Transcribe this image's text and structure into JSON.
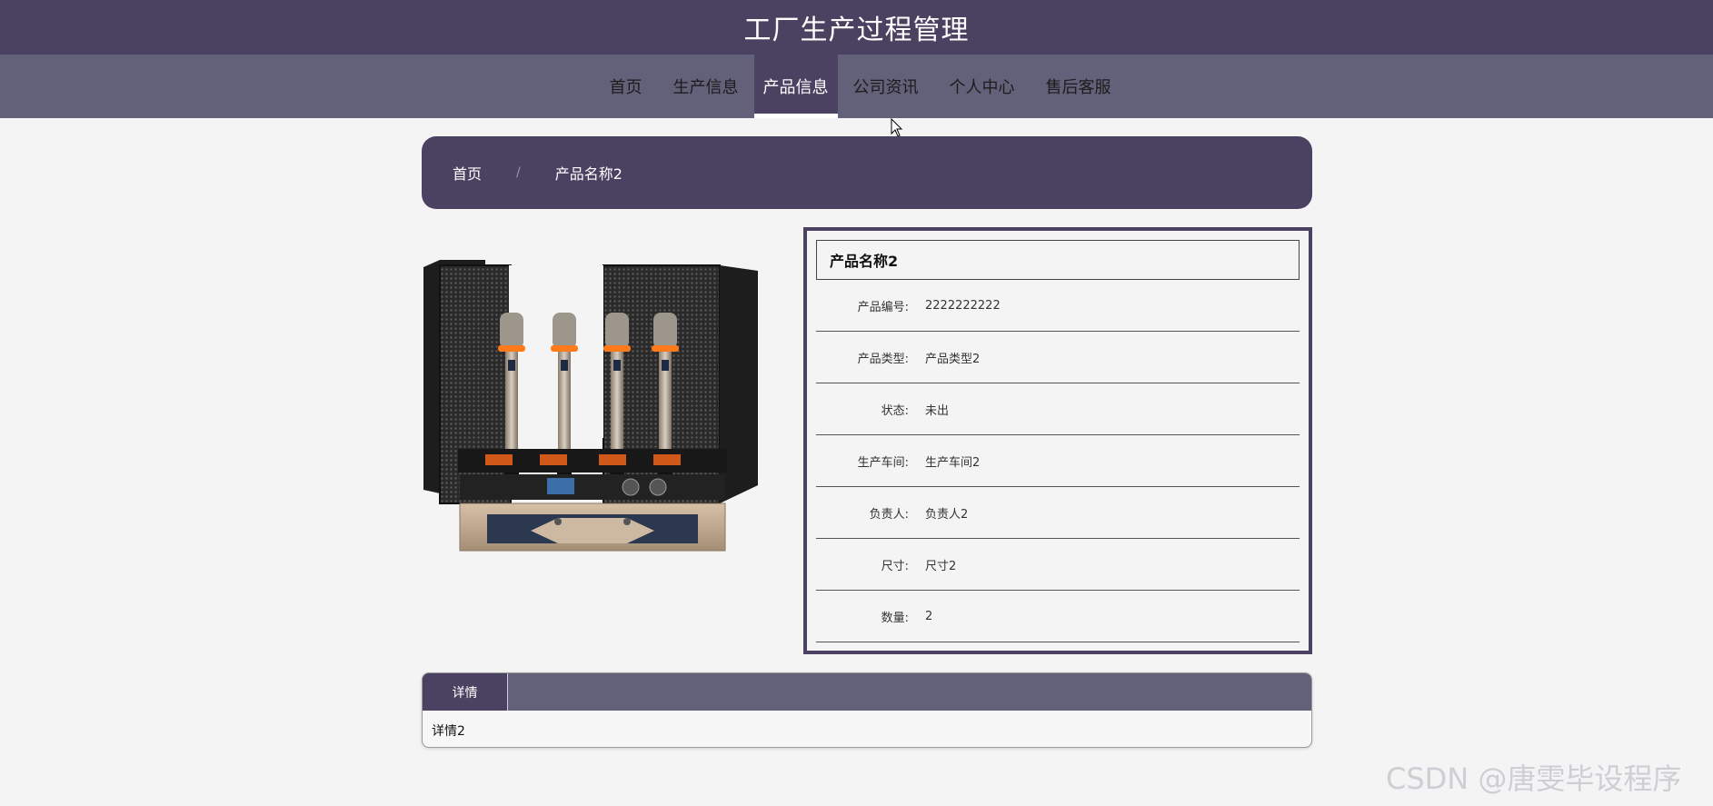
{
  "site": {
    "title": "工厂生产过程管理"
  },
  "nav": {
    "items": [
      {
        "label": "首页"
      },
      {
        "label": "生产信息"
      },
      {
        "label": "产品信息"
      },
      {
        "label": "公司资讯"
      },
      {
        "label": "个人中心"
      },
      {
        "label": "售后客服"
      }
    ],
    "active_index": 2
  },
  "breadcrumb": {
    "home": "首页",
    "separator": "/",
    "current": "产品名称2"
  },
  "product": {
    "name": "产品名称2",
    "fields": [
      {
        "label": "产品编号:",
        "value": "2222222222"
      },
      {
        "label": "产品类型:",
        "value": "产品类型2"
      },
      {
        "label": "状态:",
        "value": "未出"
      },
      {
        "label": "生产车间:",
        "value": "生产车间2"
      },
      {
        "label": "负责人:",
        "value": "负责人2"
      },
      {
        "label": "尺寸:",
        "value": "尺寸2"
      },
      {
        "label": "数量:",
        "value": "2"
      }
    ]
  },
  "tabs": {
    "items": [
      {
        "label": "详情"
      }
    ],
    "content": "详情2"
  },
  "watermark": "CSDN @唐雯毕设程序",
  "colors": {
    "primary": "#4b4262",
    "nav_bg": "#636079",
    "page_bg": "#f4f4f4"
  }
}
